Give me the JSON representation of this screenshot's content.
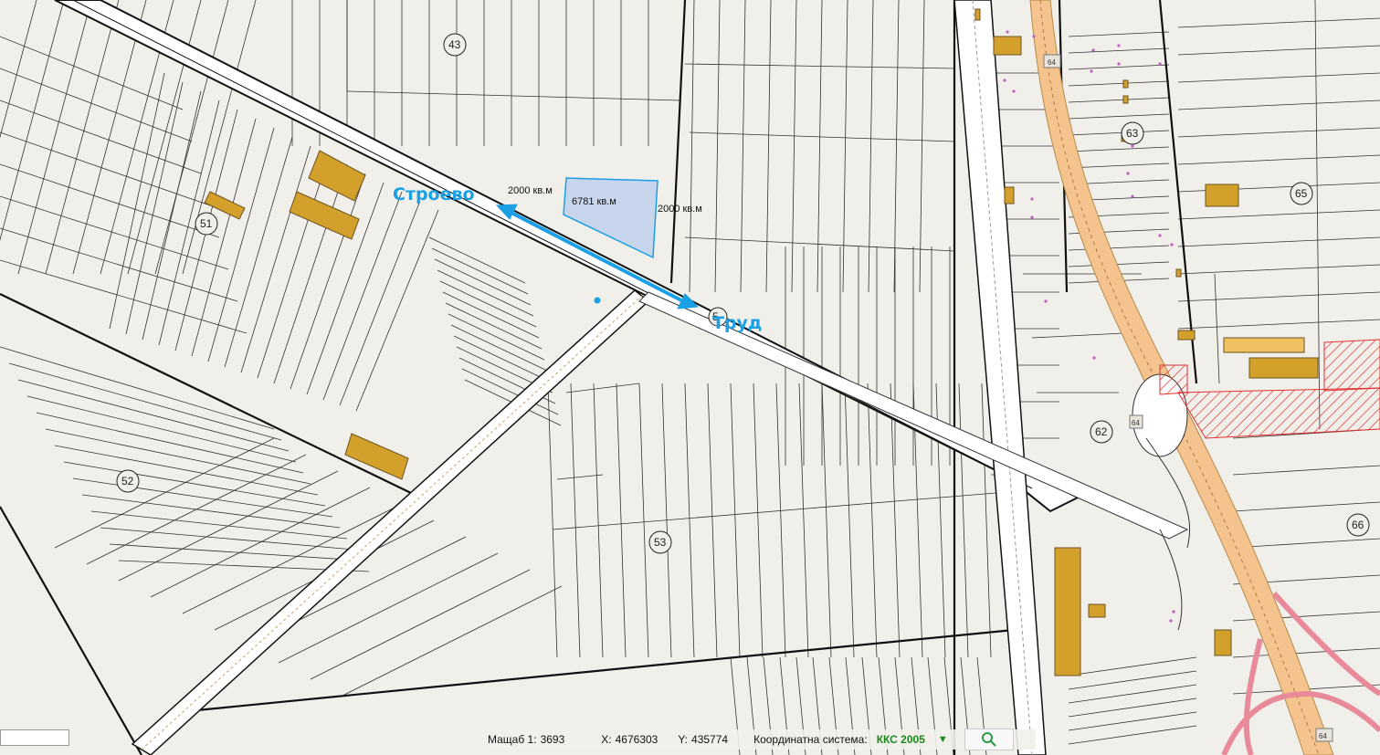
{
  "map": {
    "parcel_numbers": [
      "43",
      "51",
      "52",
      "53",
      "62",
      "63",
      "65",
      "66",
      "5"
    ],
    "area_labels": {
      "left": "2000 кв.м",
      "center": "6781 кв.м",
      "right": "2000 кв.м"
    },
    "towns": {
      "west": "Строево",
      "east": "Труд"
    },
    "road_numbers": [
      "64",
      "64",
      "64"
    ],
    "colors": {
      "background": "#f1efea",
      "building": "#d4a02c",
      "highlight_parcel": "#c7d6ec",
      "arrow": "#1ba0e6",
      "highway": "#f5c48e",
      "ramp": "#e88a9a",
      "hatch": "#e03030",
      "building_pink": "#c060c0"
    },
    "icons": [
      "double-arrow-icon",
      "search-icon",
      "dropdown-triangle-icon"
    ]
  },
  "status_bar": {
    "scale_label": "Мащаб 1:",
    "scale_value": "3693",
    "x_label": "X:",
    "x_value": "4676303",
    "y_label": "Y:",
    "y_value": "435774",
    "crs_label": "Координатна система:",
    "crs_value": "ККС 2005",
    "dropdown_glyph": "▼"
  }
}
